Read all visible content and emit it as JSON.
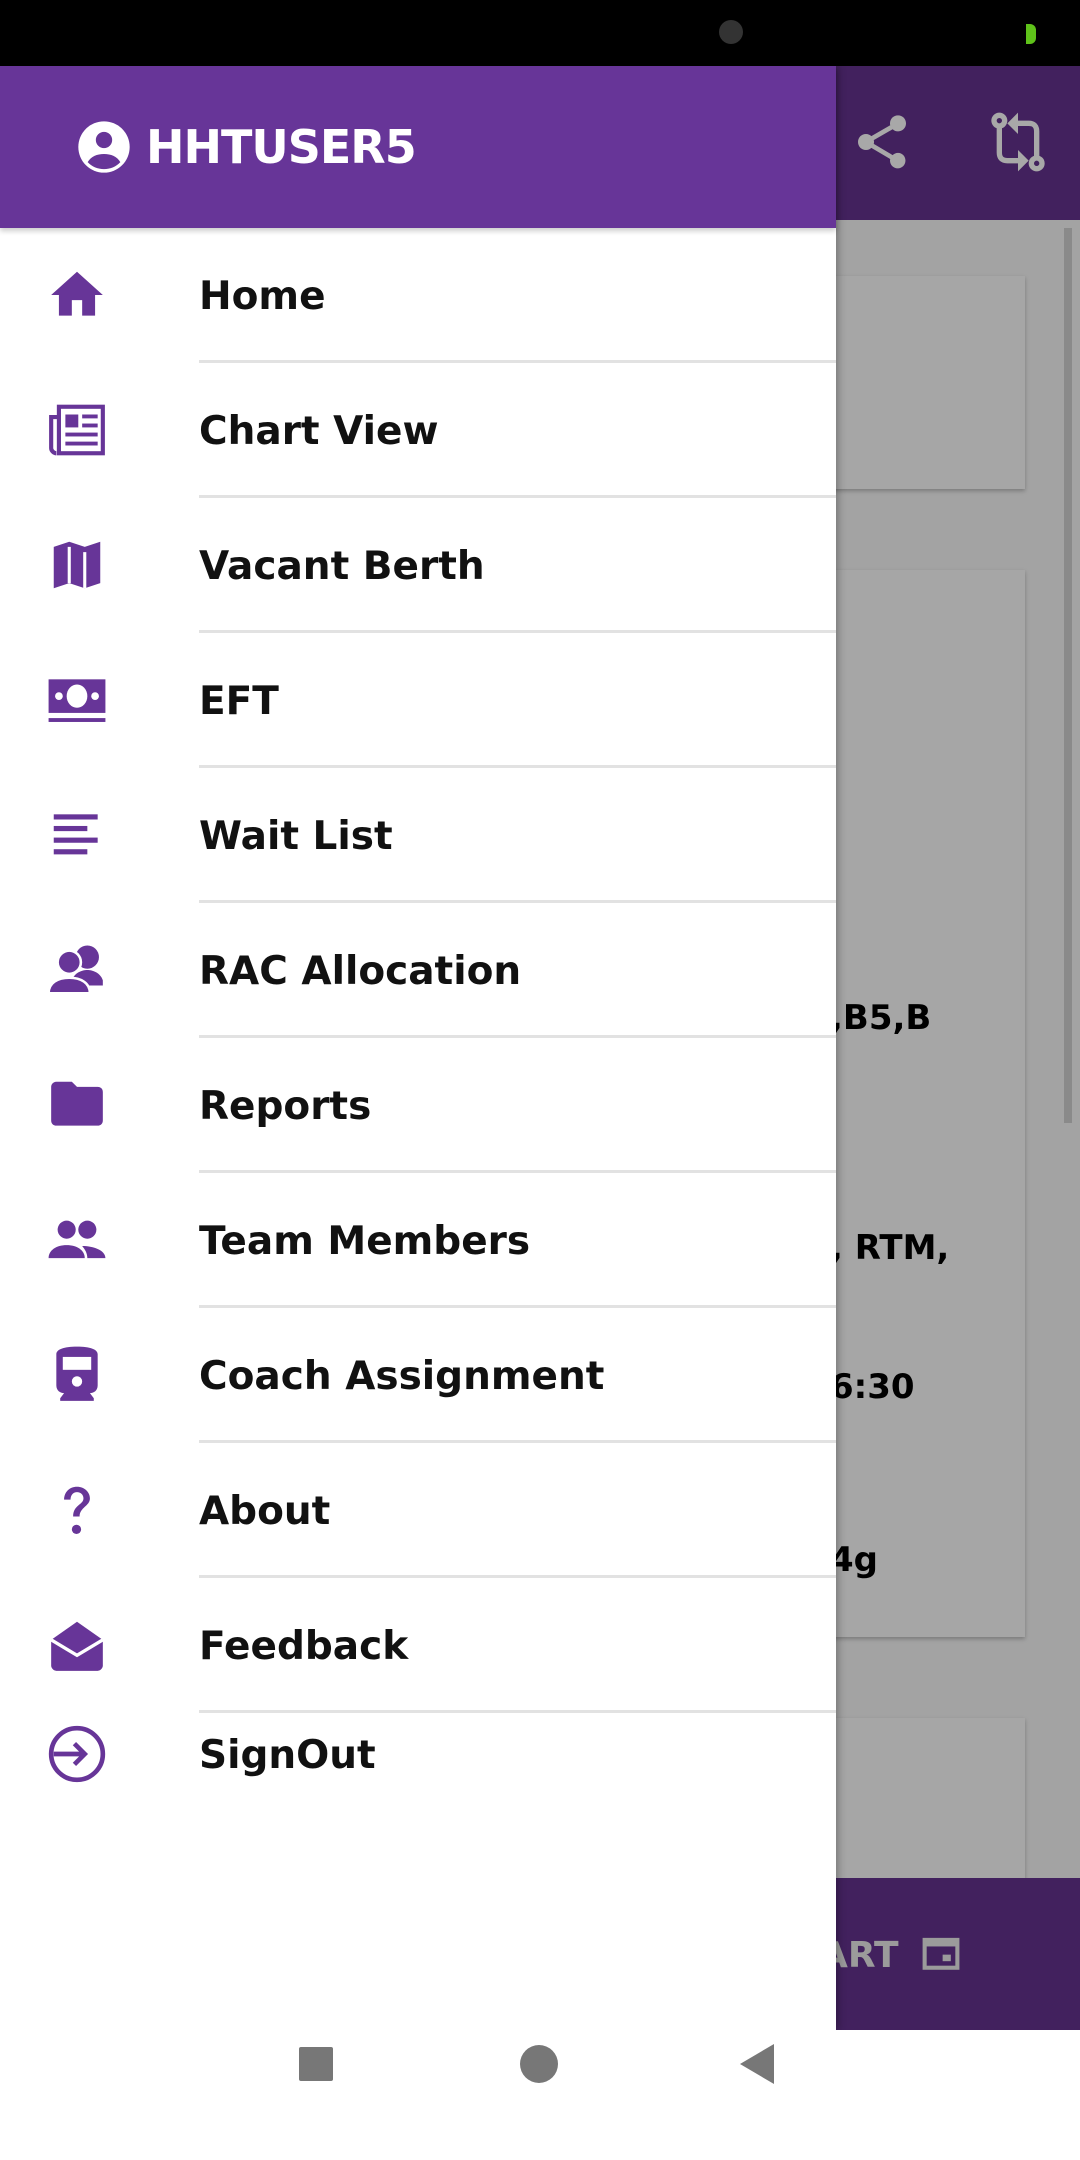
{
  "status_bar": {
    "icons": [
      "alarm-icon",
      "battery-icon"
    ],
    "battery_color": "#5fc21a"
  },
  "colors": {
    "drawer_header": "#673598",
    "app_bar": "#42215e",
    "accent": "#673598"
  },
  "drawer": {
    "user": "HHTUSER5",
    "items": [
      {
        "label": "Home",
        "icon": "home-icon"
      },
      {
        "label": "Chart View",
        "icon": "newspaper-icon"
      },
      {
        "label": "Vacant Berth",
        "icon": "map-icon"
      },
      {
        "label": "EFT",
        "icon": "money-icon"
      },
      {
        "label": "Wait List",
        "icon": "list-icon"
      },
      {
        "label": "RAC Allocation",
        "icon": "users-icon"
      },
      {
        "label": "Reports",
        "icon": "folder-icon"
      },
      {
        "label": "Team Members",
        "icon": "team-icon"
      },
      {
        "label": "Coach Assignment",
        "icon": "train-icon"
      },
      {
        "label": "About",
        "icon": "question-icon"
      },
      {
        "label": "Feedback",
        "icon": "envelope-open-icon"
      },
      {
        "label": "SignOut",
        "icon": "sign-in-icon"
      }
    ]
  },
  "background": {
    "fragments": [
      ",B5,B",
      ", RTM,",
      "6:30",
      "4g"
    ],
    "bottom_button": "ART"
  }
}
